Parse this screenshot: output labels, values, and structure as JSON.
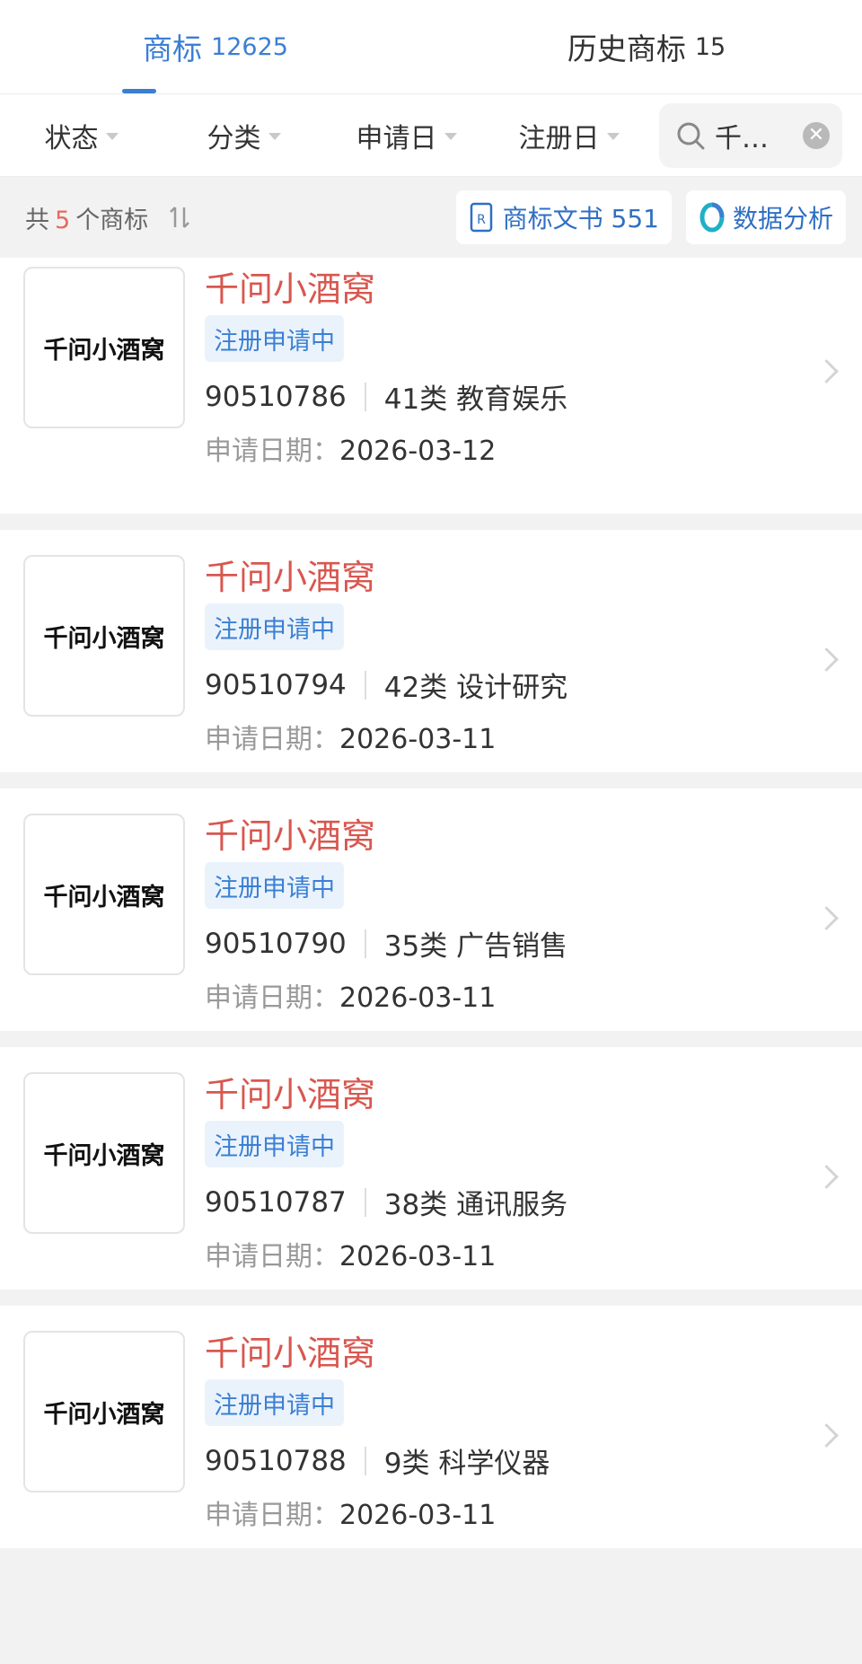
{
  "tabs": [
    {
      "label": "商标",
      "count": "12625",
      "active": true
    },
    {
      "label": "历史商标",
      "count": "15",
      "active": false
    }
  ],
  "filters": [
    "状态",
    "分类",
    "申请日",
    "注册日"
  ],
  "search": {
    "value": "千…"
  },
  "summary": {
    "prefix": "共",
    "count": "5",
    "suffix": "个商标",
    "docs_button": "商标文书 551",
    "analysis_button": "数据分析"
  },
  "trademarks": [
    {
      "thumb_text": "千问小酒窝",
      "name": "千问小酒窝",
      "status": "注册申请中",
      "number": "90510786",
      "class": "41类 教育娱乐",
      "date_label": "申请日期：",
      "date": "2026-03-12"
    },
    {
      "thumb_text": "千问小酒窝",
      "name": "千问小酒窝",
      "status": "注册申请中",
      "number": "90510794",
      "class": "42类 设计研究",
      "date_label": "申请日期：",
      "date": "2026-03-11"
    },
    {
      "thumb_text": "千问小酒窝",
      "name": "千问小酒窝",
      "status": "注册申请中",
      "number": "90510790",
      "class": "35类 广告销售",
      "date_label": "申请日期：",
      "date": "2026-03-11"
    },
    {
      "thumb_text": "千问小酒窝",
      "name": "千问小酒窝",
      "status": "注册申请中",
      "number": "90510787",
      "class": "38类 通讯服务",
      "date_label": "申请日期：",
      "date": "2026-03-11"
    },
    {
      "thumb_text": "千问小酒窝",
      "name": "千问小酒窝",
      "status": "注册申请中",
      "number": "90510788",
      "class": "9类 科学仪器",
      "date_label": "申请日期：",
      "date": "2026-03-11"
    }
  ],
  "colors": {
    "accent": "#3b7fd4",
    "name": "#d8574f",
    "count": "#e56a5f"
  }
}
